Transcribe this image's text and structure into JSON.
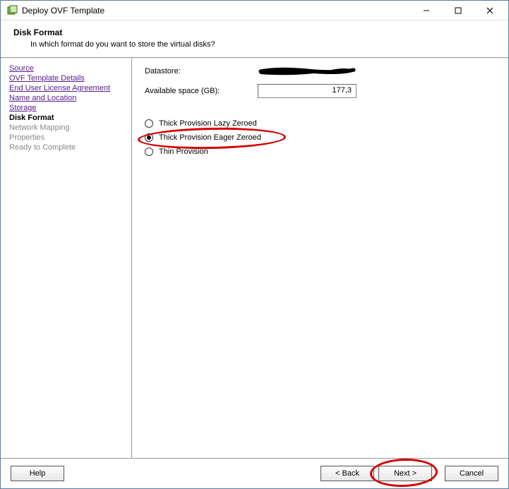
{
  "window": {
    "title": "Deploy OVF Template"
  },
  "header": {
    "title": "Disk Format",
    "description": "In which format do you want to store the virtual disks?"
  },
  "steps": {
    "source": "Source",
    "ovf_details": "OVF Template Details",
    "eula": "End User License Agreement",
    "name_location": "Name and Location",
    "storage": "Storage",
    "disk_format": "Disk Format",
    "network_mapping": "Network Mapping",
    "properties": "Properties",
    "ready": "Ready to Complete"
  },
  "content": {
    "datastore_label": "Datastore:",
    "available_label": "Available space (GB):",
    "available_value": "177,3",
    "radio1": "Thick Provision Lazy Zeroed",
    "radio2": "Thick Provision Eager Zeroed",
    "radio3": "Thin Provision"
  },
  "footer": {
    "help": "Help",
    "back": "< Back",
    "next": "Next >",
    "cancel": "Cancel"
  }
}
